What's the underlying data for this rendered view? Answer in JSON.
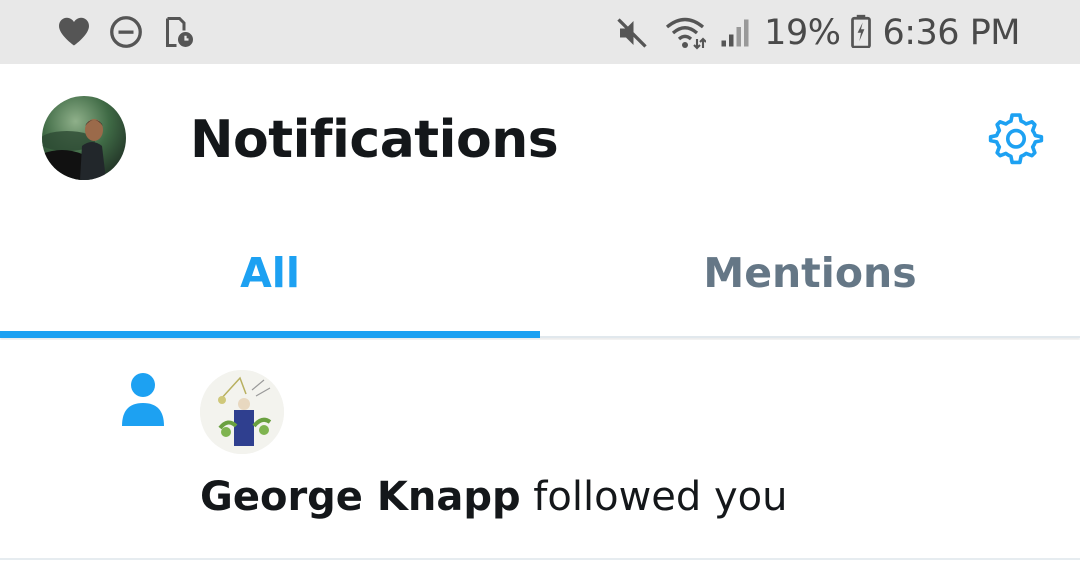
{
  "status_bar": {
    "left_icons": [
      "heart-icon",
      "do-not-disturb-icon",
      "screenshot-icon"
    ],
    "right_icons": [
      "mute-icon",
      "wifi-icon",
      "signal-icon",
      "battery-charging-icon"
    ],
    "battery_percent": "19%",
    "time": "6:36 PM"
  },
  "header": {
    "title": "Notifications",
    "profile_avatar": "avatar",
    "settings_icon": "gear-icon"
  },
  "tabs": [
    {
      "label": "All",
      "active": true
    },
    {
      "label": "Mentions",
      "active": false
    }
  ],
  "notifications": [
    {
      "type_icon": "person-icon",
      "user_name": "George Knapp",
      "action": " followed you"
    }
  ],
  "colors": {
    "accent": "#1da1f2",
    "text_primary": "#14171a",
    "text_secondary": "#657786",
    "status_bar_bg": "#e8e8e8"
  }
}
